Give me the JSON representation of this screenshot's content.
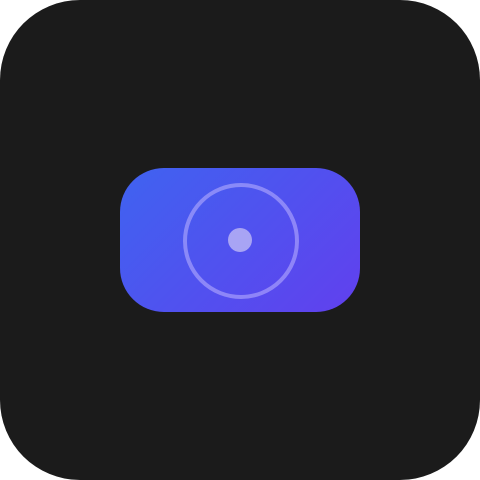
{
  "icon": {
    "name": "camera-icon",
    "colors": {
      "background": "#1b1b1b",
      "body_gradient_start": "#3f63f0",
      "body_gradient_end": "#6140ee",
      "lens_ring": "#beb4ff",
      "lens_dot": "#a8a4f4"
    }
  }
}
